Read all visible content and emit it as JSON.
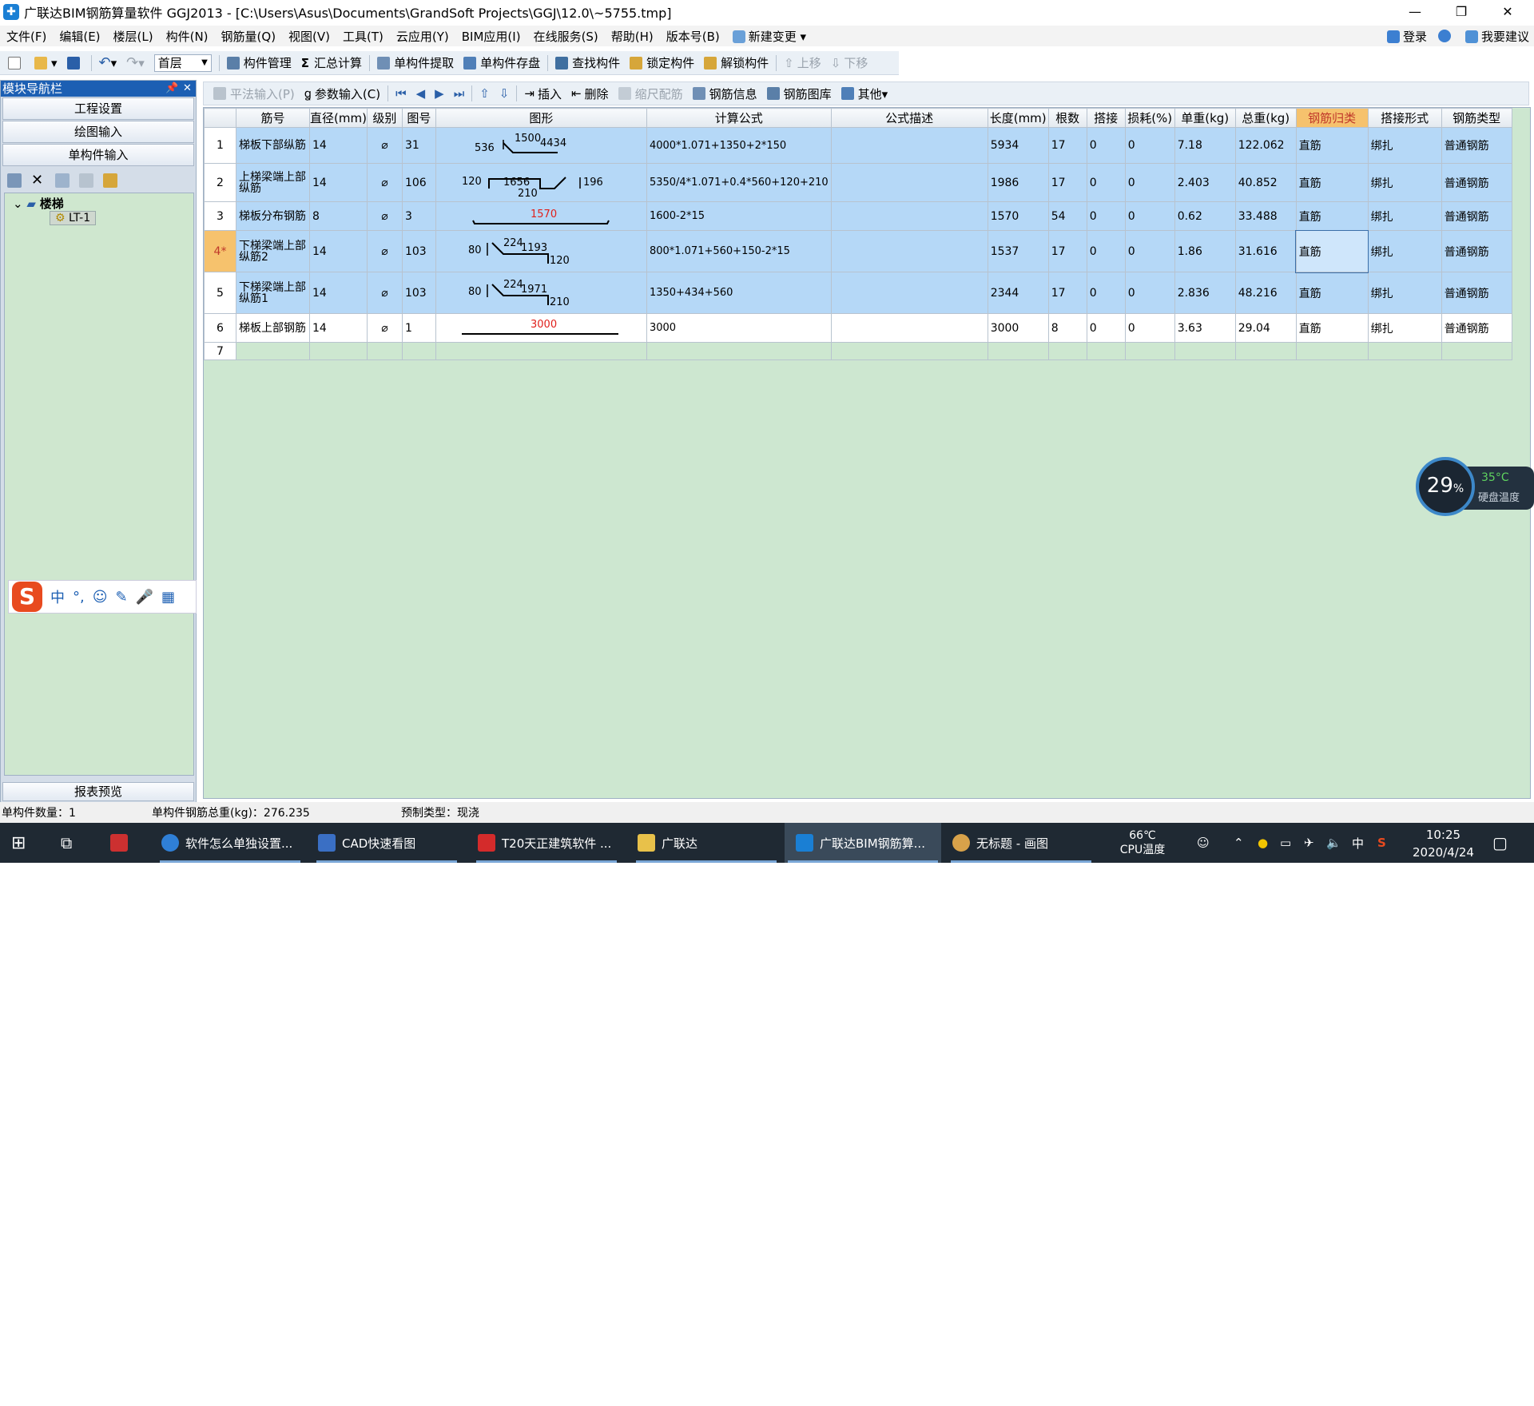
{
  "window": {
    "title": "广联达BIM钢筋算量软件 GGJ2013 - [C:\\Users\\Asus\\Documents\\GrandSoft Projects\\GGJ\\12.0\\~5755.tmp]",
    "minimize": "—",
    "restore": "❐",
    "close": "✕"
  },
  "menu": {
    "items": [
      "文件(F)",
      "编辑(E)",
      "楼层(L)",
      "构件(N)",
      "钢筋量(Q)",
      "视图(V)",
      "工具(T)",
      "云应用(Y)",
      "BIM应用(I)",
      "在线服务(S)",
      "帮助(H)",
      "版本号(B)",
      "新建变更 ▾"
    ],
    "login": "登录",
    "suggest": "我要建议"
  },
  "toolbar": {
    "floor": "首层",
    "items": [
      "构件管理",
      "汇总计算",
      "单构件提取",
      "单构件存盘",
      "查找构件",
      "锁定构件",
      "解锁构件",
      "上移",
      "下移"
    ]
  },
  "left_panel": {
    "title": "模块导航栏",
    "pin": "📌",
    "close": "✕",
    "tabs": [
      "工程设置",
      "绘图输入",
      "单构件输入"
    ],
    "tree_root": "楼梯",
    "tree_child": "LT-1",
    "bottom": "报表预览"
  },
  "ime": {
    "logo": "S",
    "items": [
      "中",
      "°,",
      "☺",
      "✎",
      "🎤",
      "▦"
    ]
  },
  "editbar": {
    "items": [
      "平法输入(P)",
      "参数输入(C)",
      "插入",
      "删除",
      "缩尺配筋",
      "钢筋信息",
      "钢筋图库",
      "其他▾"
    ]
  },
  "grid": {
    "columns": [
      "筋号",
      "直径(mm)",
      "级别",
      "图号",
      "图形",
      "计算公式",
      "公式描述",
      "长度(mm)",
      "根数",
      "搭接",
      "损耗(%)",
      "单重(kg)",
      "总重(kg)",
      "钢筋归类",
      "搭接形式",
      "钢筋类型"
    ],
    "rows": [
      {
        "no": "1",
        "name": "梯板下部纵筋",
        "dia": "14",
        "grade": "⌀",
        "fig": "31",
        "s": [
          "536",
          "1500",
          "4434"
        ],
        "formula": "4000*1.071+1350+2*150",
        "desc": "",
        "len": "5934",
        "count": "17",
        "lap": "0",
        "loss": "0",
        "uw": "7.18",
        "tw": "122.062",
        "cls": "直筋",
        "lapform": "绑扎",
        "type": "普通钢筋"
      },
      {
        "no": "2",
        "name": "上梯梁端上部纵筋",
        "dia": "14",
        "grade": "⌀",
        "fig": "106",
        "s": [
          "120",
          "1656",
          "210",
          "196"
        ],
        "formula": "5350/4*1.071+0.4*560+120+210",
        "desc": "",
        "len": "1986",
        "count": "17",
        "lap": "0",
        "loss": "0",
        "uw": "2.403",
        "tw": "40.852",
        "cls": "直筋",
        "lapform": "绑扎",
        "type": "普通钢筋"
      },
      {
        "no": "3",
        "name": "梯板分布钢筋",
        "dia": "8",
        "grade": "⌀",
        "fig": "3",
        "s": [
          "1570"
        ],
        "formula": "1600-2*15",
        "desc": "",
        "len": "1570",
        "count": "54",
        "lap": "0",
        "loss": "0",
        "uw": "0.62",
        "tw": "33.488",
        "cls": "直筋",
        "lapform": "绑扎",
        "type": "普通钢筋"
      },
      {
        "no": "4*",
        "name": "下梯梁端上部纵筋2",
        "dia": "14",
        "grade": "⌀",
        "fig": "103",
        "s": [
          "80",
          "224",
          "1193",
          "120"
        ],
        "formula": "800*1.071+560+150-2*15",
        "desc": "",
        "len": "1537",
        "count": "17",
        "lap": "0",
        "loss": "0",
        "uw": "1.86",
        "tw": "31.616",
        "cls": "直筋",
        "lapform": "绑扎",
        "type": "普通钢筋"
      },
      {
        "no": "5",
        "name": "下梯梁端上部纵筋1",
        "dia": "14",
        "grade": "⌀",
        "fig": "103",
        "s": [
          "80",
          "224",
          "1971",
          "210"
        ],
        "formula": "1350+434+560",
        "desc": "",
        "len": "2344",
        "count": "17",
        "lap": "0",
        "loss": "0",
        "uw": "2.836",
        "tw": "48.216",
        "cls": "直筋",
        "lapform": "绑扎",
        "type": "普通钢筋"
      },
      {
        "no": "6",
        "name": "梯板上部钢筋",
        "dia": "14",
        "grade": "⌀",
        "fig": "1",
        "s": [
          "3000"
        ],
        "formula": "3000",
        "desc": "",
        "len": "3000",
        "count": "8",
        "lap": "0",
        "loss": "0",
        "uw": "3.63",
        "tw": "29.04",
        "cls": "直筋",
        "lapform": "绑扎",
        "type": "普通钢筋"
      },
      {
        "no": "7"
      }
    ]
  },
  "gauge": {
    "percent": "29",
    "unit": "%",
    "temp": "35°C",
    "label": "硬盘温度"
  },
  "status": {
    "count": "单构件数量：1",
    "total": "单构件钢筋总重(kg)：276.235",
    "type": "预制类型：现浇"
  },
  "taskbar": {
    "apps": [
      "软件怎么单独设置...",
      "CAD快速看图",
      "T20天正建筑软件 ...",
      "广联达",
      "广联达BIM钢筋算...",
      "无标题 - 画图"
    ],
    "cpu_temp": "66℃",
    "cpu_label": "CPU温度",
    "ime": "中",
    "time": "10:25",
    "date": "2020/4/24"
  },
  "colors": {
    "selected_row": "#b5d8f7",
    "grid_bg": "#cde7d0",
    "highlight": "#f6c26d",
    "red_text": "#e0201b"
  }
}
